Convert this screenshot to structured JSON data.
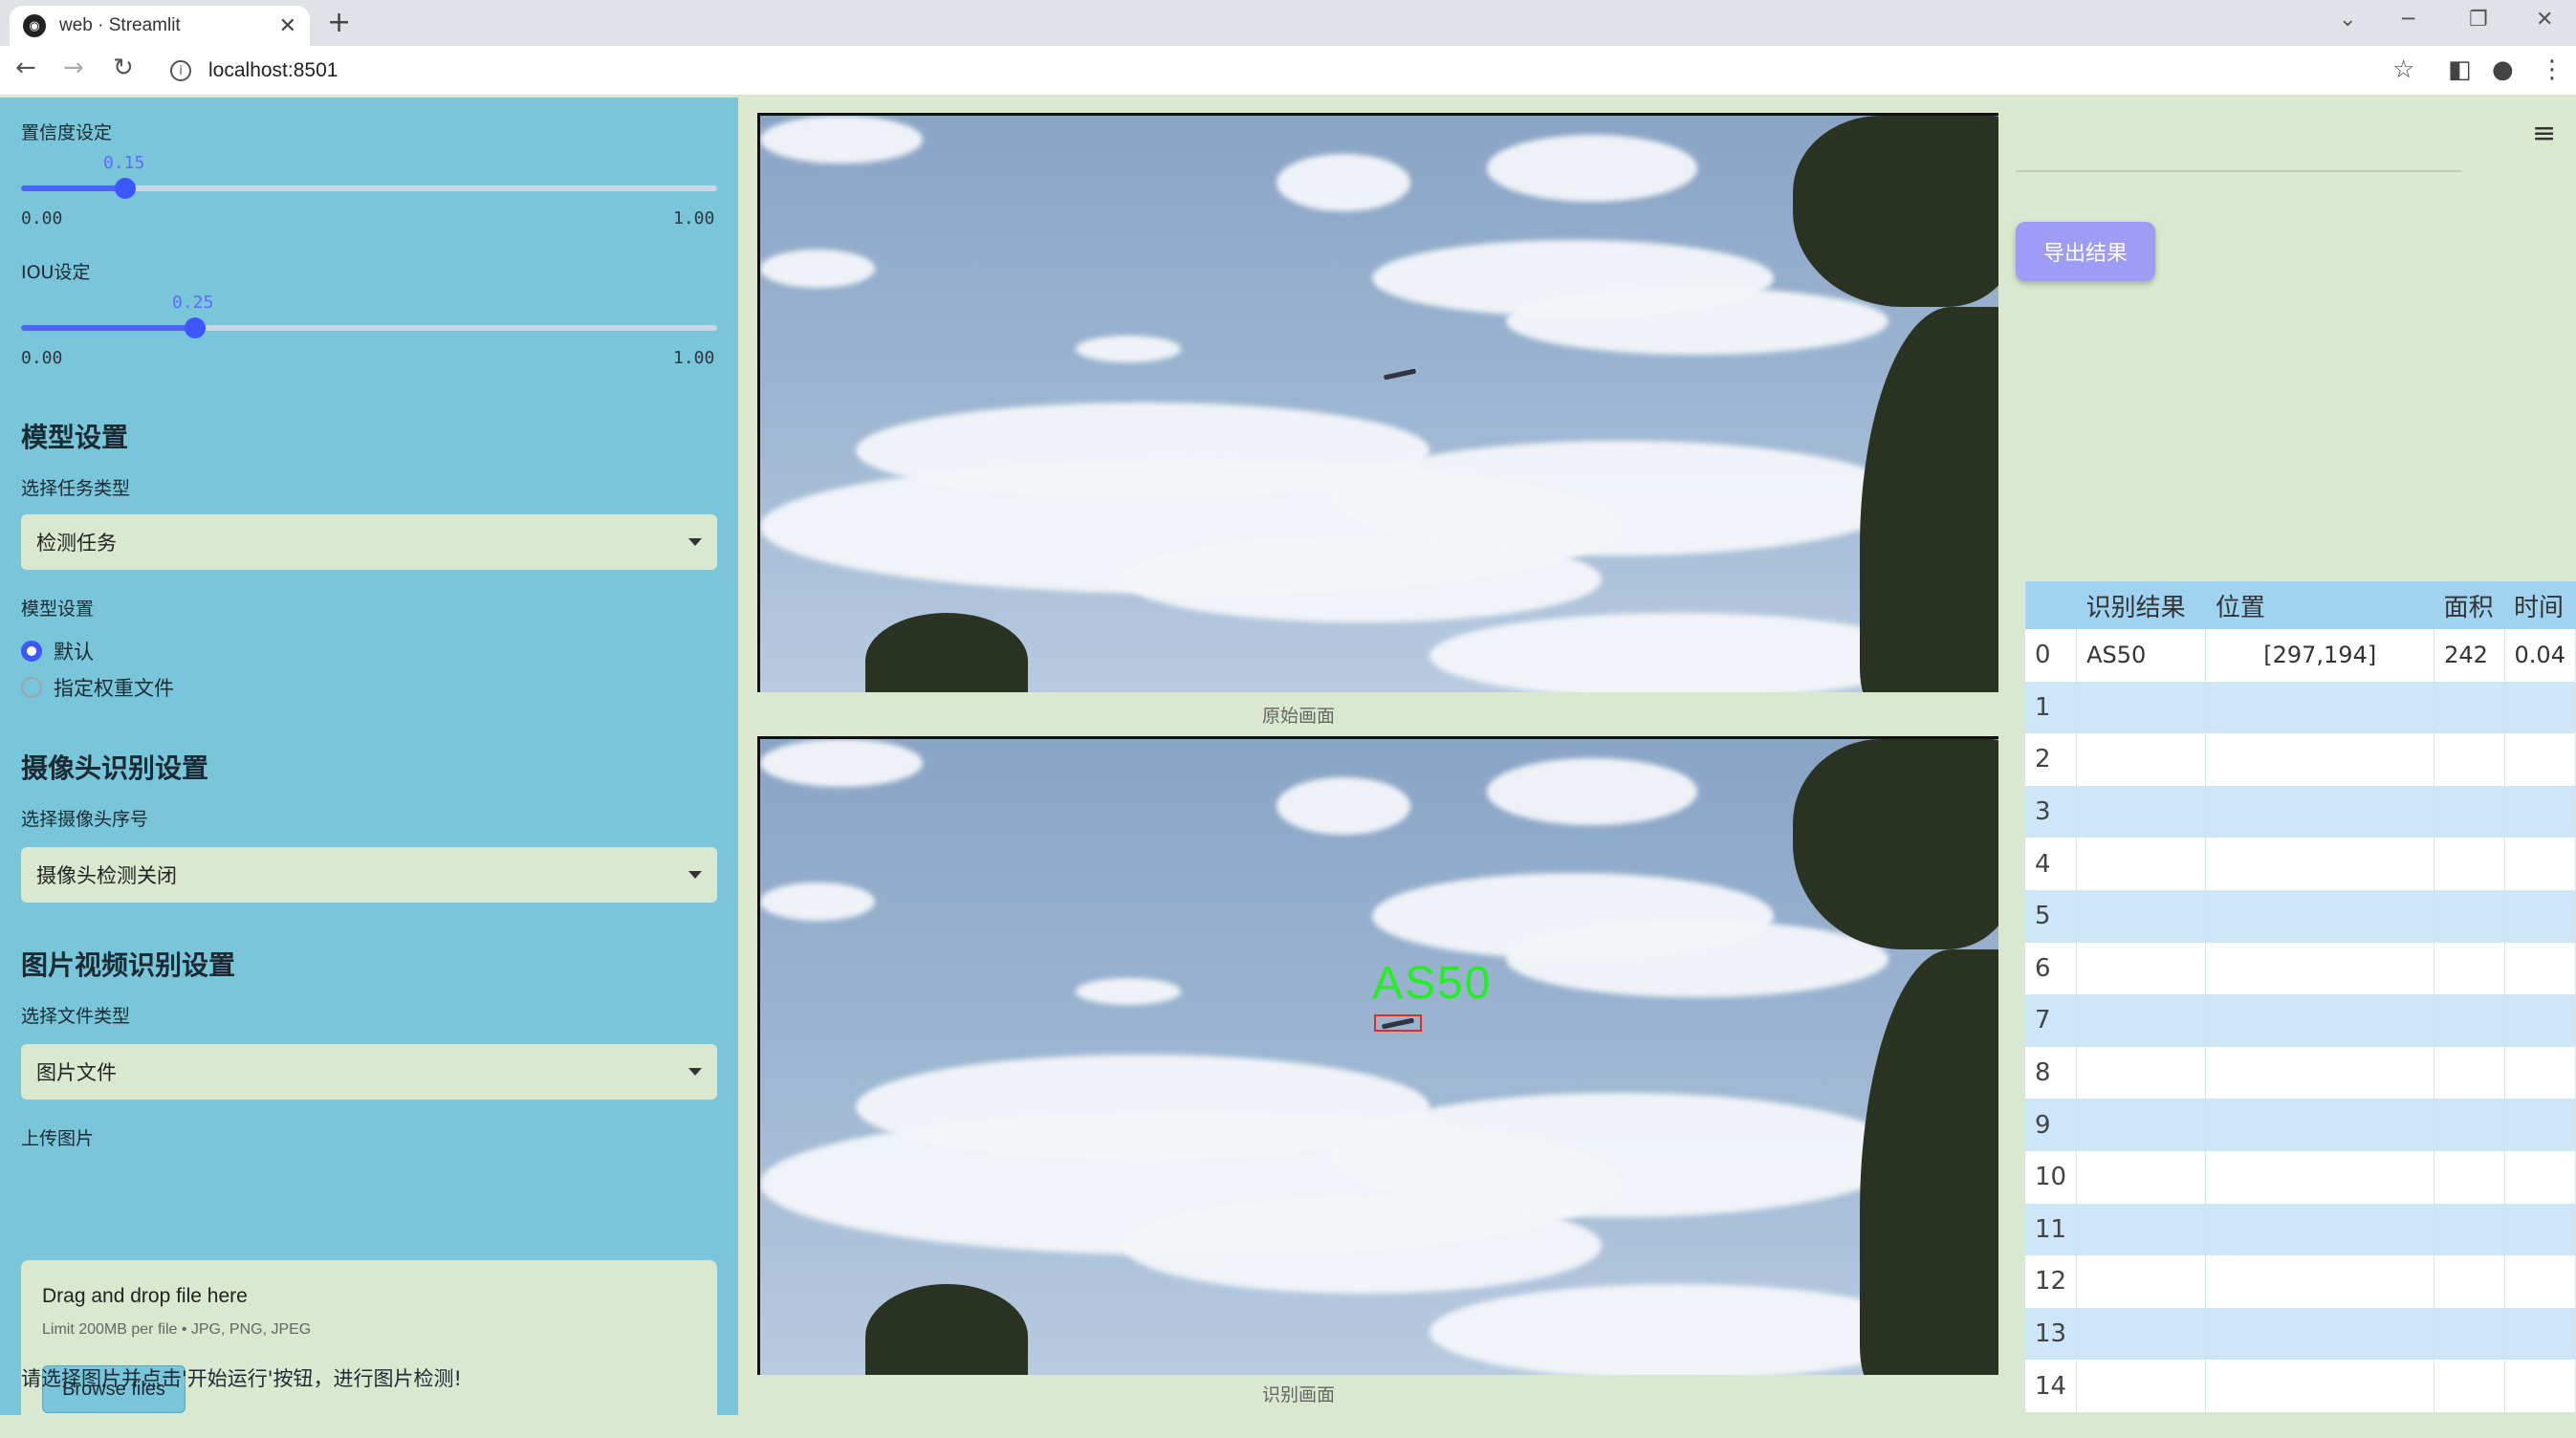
{
  "browser": {
    "tab_title": "web · Streamlit",
    "url": "localhost:8501",
    "new_tab": "+",
    "tab_close": "✕"
  },
  "sidebar": {
    "confidence": {
      "label": "置信度设定",
      "value": "0.15",
      "min": "0.00",
      "max": "1.00",
      "fraction": 0.15
    },
    "iou": {
      "label": "IOU设定",
      "value": "0.25",
      "min": "0.00",
      "max": "1.00",
      "fraction": 0.25
    },
    "model_section": {
      "title": "模型设置",
      "task_label": "选择任务类型",
      "task_value": "检测任务",
      "weights_label": "模型设置",
      "weights_options": [
        {
          "label": "默认",
          "selected": true
        },
        {
          "label": "指定权重文件",
          "selected": false
        }
      ]
    },
    "camera_section": {
      "title": "摄像头识别设置",
      "camera_label": "选择摄像头序号",
      "camera_value": "摄像头检测关闭"
    },
    "media_section": {
      "title": "图片视频识别设置",
      "file_type_label": "选择文件类型",
      "file_type_value": "图片文件",
      "upload_label": "上传图片",
      "drop_text": "Drag and drop file here",
      "limit_text": "Limit 200MB per file • JPG, PNG, JPEG",
      "browse_label": "Browse files"
    },
    "hint": "请选择图片并点击'开始运行'按钮，进行图片检测!"
  },
  "main": {
    "original_caption": "原始画面",
    "result_caption": "识别画面",
    "detection_label": "AS50"
  },
  "right": {
    "export_label": "导出结果",
    "table": {
      "headers": [
        "",
        "识别结果",
        "位置",
        "面积",
        "时间"
      ],
      "rows": [
        {
          "idx": "0",
          "result": "AS50",
          "position": "[297,194]",
          "area": "242",
          "time": "0.04"
        },
        {
          "idx": "1",
          "result": "",
          "position": "",
          "area": "",
          "time": ""
        },
        {
          "idx": "2",
          "result": "",
          "position": "",
          "area": "",
          "time": ""
        },
        {
          "idx": "3",
          "result": "",
          "position": "",
          "area": "",
          "time": ""
        },
        {
          "idx": "4",
          "result": "",
          "position": "",
          "area": "",
          "time": ""
        },
        {
          "idx": "5",
          "result": "",
          "position": "",
          "area": "",
          "time": ""
        },
        {
          "idx": "6",
          "result": "",
          "position": "",
          "area": "",
          "time": ""
        },
        {
          "idx": "7",
          "result": "",
          "position": "",
          "area": "",
          "time": ""
        },
        {
          "idx": "8",
          "result": "",
          "position": "",
          "area": "",
          "time": ""
        },
        {
          "idx": "9",
          "result": "",
          "position": "",
          "area": "",
          "time": ""
        },
        {
          "idx": "10",
          "result": "",
          "position": "",
          "area": "",
          "time": ""
        },
        {
          "idx": "11",
          "result": "",
          "position": "",
          "area": "",
          "time": ""
        },
        {
          "idx": "12",
          "result": "",
          "position": "",
          "area": "",
          "time": ""
        },
        {
          "idx": "13",
          "result": "",
          "position": "",
          "area": "",
          "time": ""
        },
        {
          "idx": "14",
          "result": "",
          "position": "",
          "area": "",
          "time": ""
        }
      ]
    }
  },
  "colors": {
    "sidebar_bg": "#79c6da",
    "page_bg": "#d9e8cf",
    "accent": "#3d57ff",
    "export_btn": "#9f9bf6",
    "table_header": "#9fd3f0"
  }
}
